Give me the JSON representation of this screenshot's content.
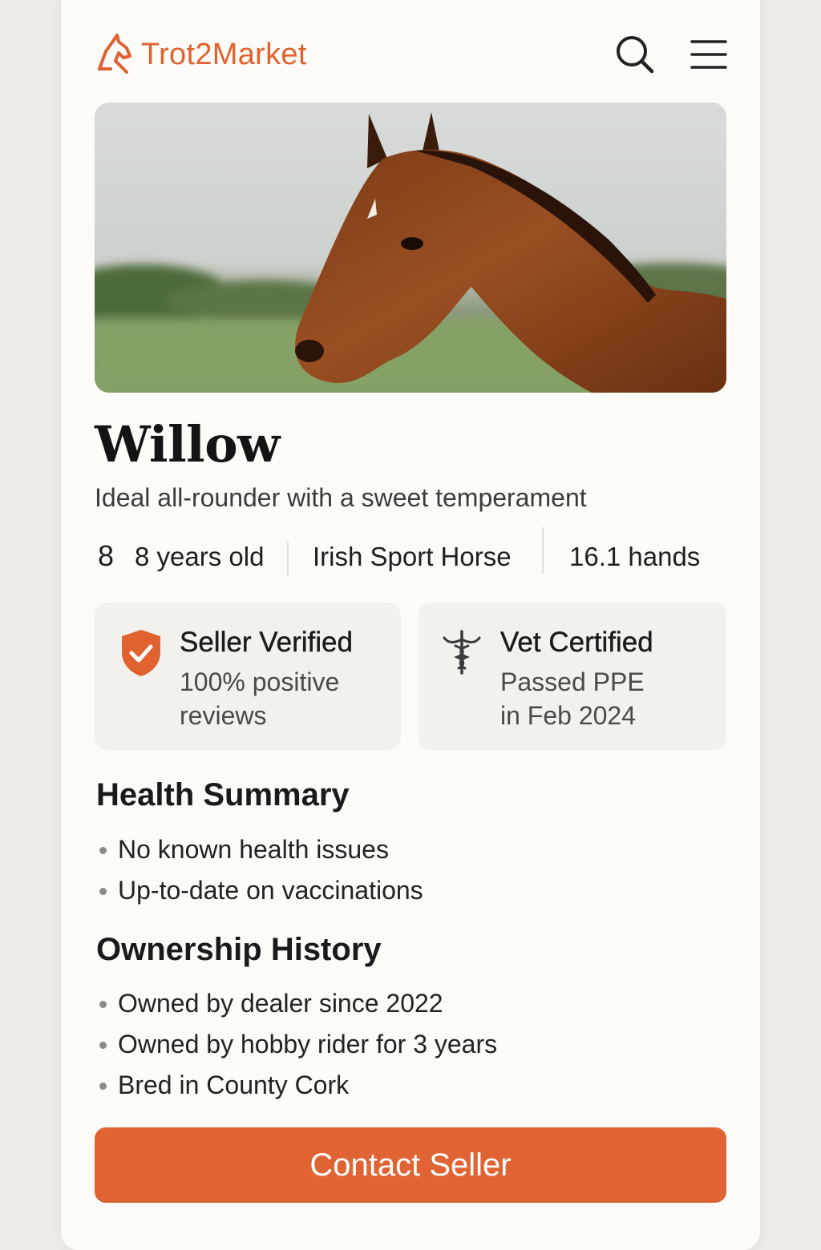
{
  "brand": {
    "name": "Trot2Market",
    "accent_color": "#e0622f"
  },
  "header": {
    "search_icon": "search-icon",
    "menu_icon": "hamburger-menu-icon"
  },
  "listing": {
    "photo_subject": "bay horse head in a green field",
    "name": "Willow",
    "tagline": "Ideal all-rounder with a sweet temperament",
    "stats": {
      "age_number": "8",
      "age": "8 years old",
      "breed": "Irish Sport Horse",
      "height": "16.1  hands"
    }
  },
  "badges": {
    "seller": {
      "icon": "shield-check-icon",
      "title": "Seller Verified",
      "subtitle": "100% positive reviews"
    },
    "vet": {
      "icon": "caduceus-icon",
      "title": "Vet Certified",
      "subtitle_line1": "Passed PPE",
      "subtitle_line2": "in Feb 2024"
    }
  },
  "health": {
    "heading": "Health Summary",
    "items": [
      "No known health issues",
      "Up-to-date on vaccinations"
    ]
  },
  "ownership": {
    "heading": "Ownership History",
    "items": [
      "Owned by dealer since 2022",
      "Owned by hobby rider for 3 years",
      "Bred in County Cork"
    ]
  },
  "cta": {
    "label": "Contact Seller",
    "color": "#e06433"
  }
}
